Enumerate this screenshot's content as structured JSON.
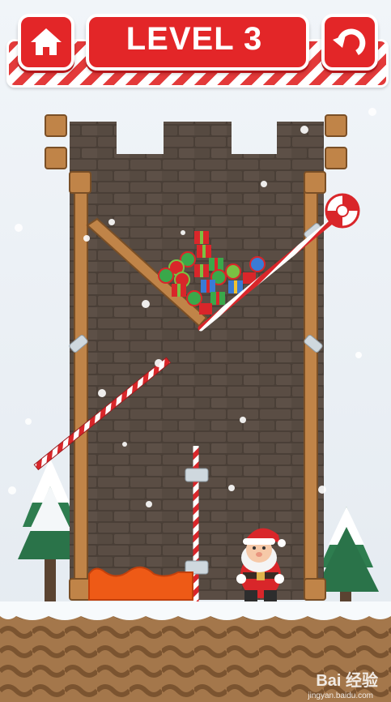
{
  "header": {
    "level_label": "LEVEL 3",
    "home_icon": "home-icon",
    "undo_icon": "undo-icon",
    "button_color": "#e32628"
  },
  "game": {
    "characters": [
      "santa"
    ],
    "items": [
      "gift-boxes"
    ],
    "hazards": [
      "lava"
    ],
    "pins": [
      "pin-diagonal",
      "pin-vertical"
    ]
  },
  "watermark": {
    "brand": "Bai 经验",
    "url": "jingyan.baidu.com"
  }
}
